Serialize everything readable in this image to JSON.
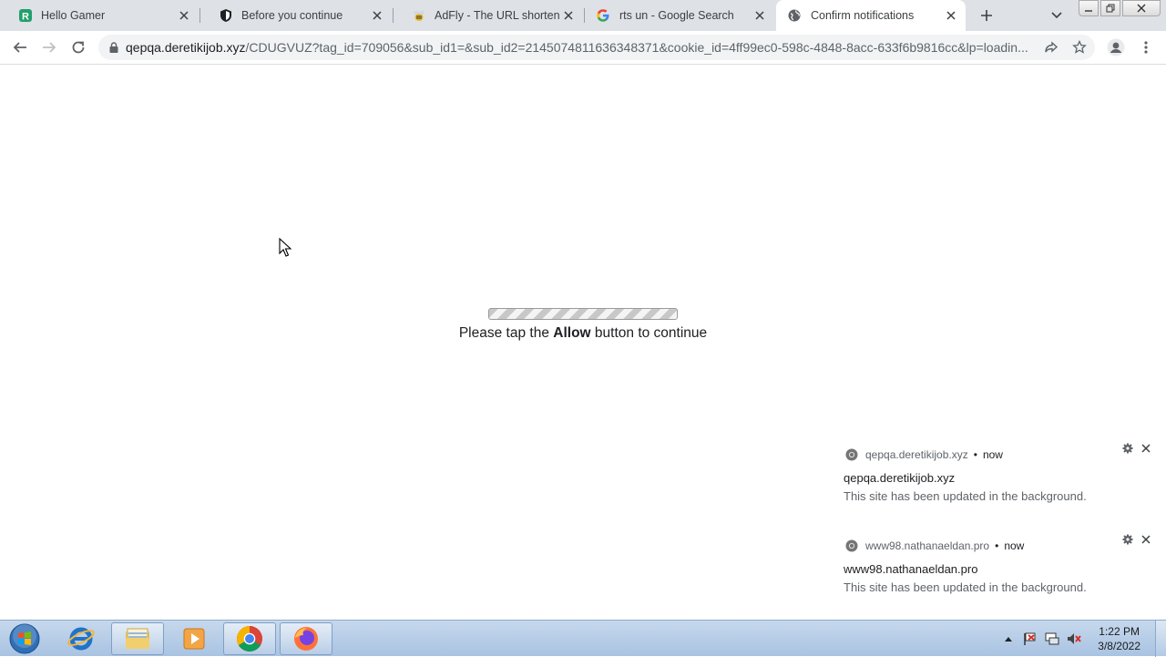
{
  "browser": {
    "tabs": [
      {
        "title": "Hello Gamer",
        "icon": "r-logo-icon"
      },
      {
        "title": "Before you continue",
        "icon": "shield-icon"
      },
      {
        "title": "AdFly - The URL shortener s",
        "icon": "adfly-bee-icon"
      },
      {
        "title": "rts un - Google Search",
        "icon": "google-icon"
      },
      {
        "title": "Confirm notifications",
        "icon": "globe-icon",
        "active": true
      }
    ],
    "address": {
      "host": "qepqa.deretikijob.xyz",
      "path": "/CDUGVUZ?tag_id=709056&sub_id1=&sub_id2=2145074811636348371&cookie_id=4ff99ec0-598c-4848-8acc-633f6b9816cc&lp=loadin..."
    }
  },
  "page": {
    "prompt_before": "Please tap the ",
    "prompt_bold": "Allow",
    "prompt_after": " button to continue"
  },
  "notifications": [
    {
      "source": "qepqa.deretikijob.xyz",
      "time": "now",
      "title": "qepqa.deretikijob.xyz",
      "body": "This site has been updated in the background."
    },
    {
      "source": "www98.nathanaeldan.pro",
      "time": "now",
      "title": "www98.nathanaeldan.pro",
      "body": "This site has been updated in the background."
    }
  ],
  "taskbar": {
    "apps": [
      "start-orb-icon",
      "internet-explorer-icon",
      "file-explorer-icon",
      "media-player-icon",
      "chrome-icon",
      "firefox-icon"
    ],
    "clock_time": "1:22 PM",
    "clock_date": "3/8/2022"
  },
  "colors": {
    "tabstrip": "#dee1e6",
    "accent_blue": "#1a73e8",
    "taskbar": "#b4cbe6"
  }
}
